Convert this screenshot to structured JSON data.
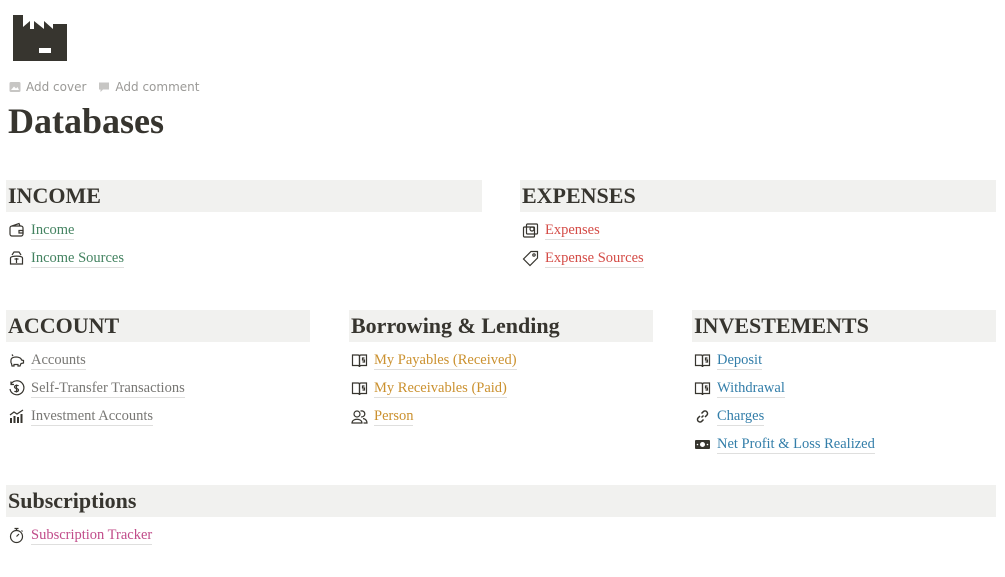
{
  "page": {
    "icon": "factory-icon",
    "actions": {
      "add_cover": "Add cover",
      "add_comment": "Add comment"
    },
    "title": "Databases"
  },
  "sections": {
    "income": {
      "title": "INCOME",
      "color": "#448361",
      "links": [
        {
          "label": "Income",
          "icon": "wallet-icon"
        },
        {
          "label": "Income Sources",
          "icon": "money-bag-icon"
        }
      ]
    },
    "expenses": {
      "title": "EXPENSES",
      "color": "#d44c47",
      "links": [
        {
          "label": "Expenses",
          "icon": "cash-icon"
        },
        {
          "label": "Expense Sources",
          "icon": "tag-icon"
        }
      ]
    },
    "account": {
      "title": "ACCOUNT",
      "color": "#787774",
      "links": [
        {
          "label": "Accounts",
          "icon": "piggy-bank-icon"
        },
        {
          "label": "Self-Transfer Transactions",
          "icon": "dollar-circle-icon"
        },
        {
          "label": "Investment Accounts",
          "icon": "chart-icon"
        }
      ]
    },
    "borrowing": {
      "title": "Borrowing & Lending",
      "color": "#cb912f",
      "links": [
        {
          "label": "My Payables (Received)",
          "icon": "ledger-icon"
        },
        {
          "label": "My Receivables (Paid)",
          "icon": "ledger-icon"
        },
        {
          "label": "Person",
          "icon": "people-icon"
        }
      ]
    },
    "investments": {
      "title": "INVESTEMENTS",
      "color": "#337ea9",
      "links": [
        {
          "label": "Deposit",
          "icon": "ledger-icon"
        },
        {
          "label": "Withdrawal",
          "icon": "ledger-icon"
        },
        {
          "label": "Charges",
          "icon": "link-icon"
        },
        {
          "label": "Net Profit & Loss Realized",
          "icon": "banknote-icon"
        }
      ]
    },
    "subscriptions": {
      "title": "Subscriptions",
      "color": "#c14c8a",
      "links": [
        {
          "label": "Subscription Tracker",
          "icon": "stopwatch-icon"
        }
      ]
    }
  }
}
